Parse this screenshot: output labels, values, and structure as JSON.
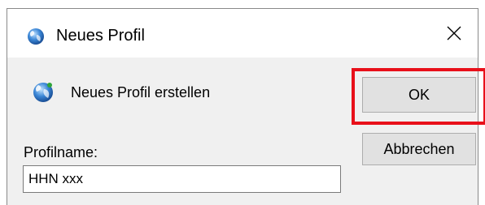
{
  "window": {
    "title": "Neues Profil",
    "title_icon": "outlook-profile-icon",
    "close_icon": "close-icon"
  },
  "content": {
    "heading": "Neues Profil erstellen",
    "heading_icon": "outlook-profile-icon"
  },
  "form": {
    "label": "Profilname:",
    "value": "HHN xxx"
  },
  "buttons": {
    "ok_label": "OK",
    "cancel_label": "Abbrechen"
  },
  "colors": {
    "highlight": "#e8101a",
    "dialog_bg": "#f0f0f0",
    "button_bg": "#e1e1e1"
  }
}
